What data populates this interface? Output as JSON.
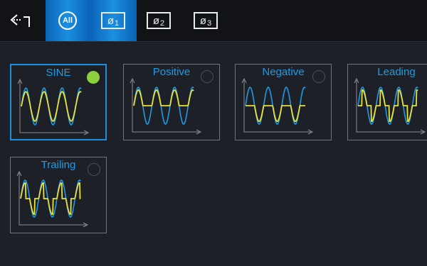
{
  "topbar": {
    "tabs": [
      {
        "label": "All",
        "active": true
      },
      {
        "label": "1",
        "active": false
      },
      {
        "label": "2",
        "active": false
      },
      {
        "label": "3",
        "active": false
      }
    ]
  },
  "waveforms": [
    {
      "title": "SINE",
      "selected": true
    },
    {
      "title": "Positive",
      "selected": false
    },
    {
      "title": "Negative",
      "selected": false
    },
    {
      "title": "Leading",
      "selected": false
    },
    {
      "title": "Trailing",
      "selected": false
    }
  ],
  "colors": {
    "accent": "#1b8fe0",
    "wave_reference": "#1e9be6",
    "wave_signal": "#e8e23a",
    "selected_indicator": "#8ccf3f"
  }
}
